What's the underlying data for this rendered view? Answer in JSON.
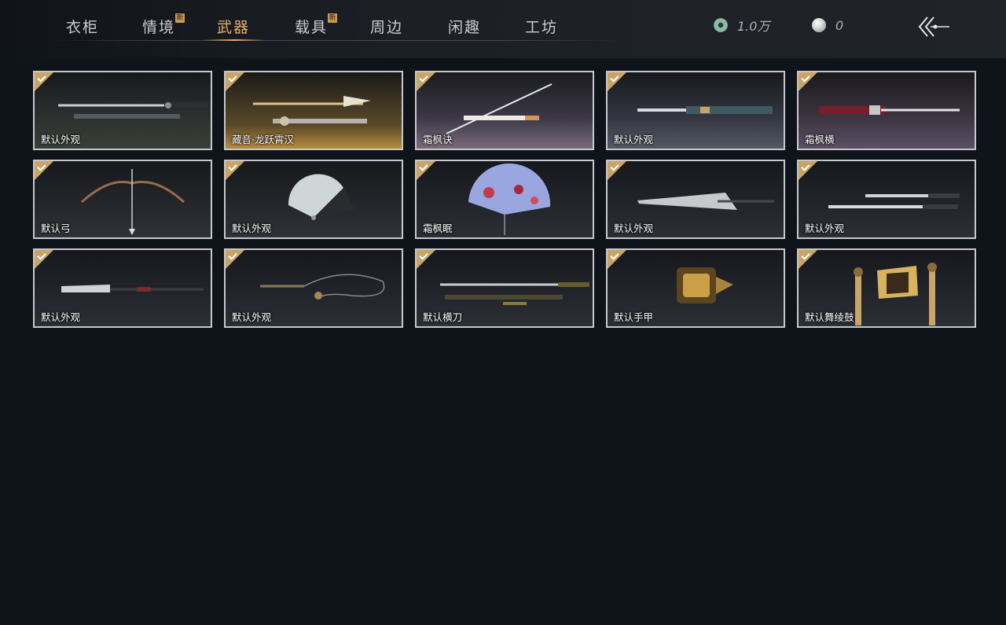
{
  "tabs": [
    {
      "label": "衣柜",
      "active": false,
      "new_badge": ""
    },
    {
      "label": "情境",
      "active": false,
      "new_badge": "新"
    },
    {
      "label": "武器",
      "active": true,
      "new_badge": ""
    },
    {
      "label": "载具",
      "active": false,
      "new_badge": "新"
    },
    {
      "label": "周边",
      "active": false,
      "new_badge": ""
    },
    {
      "label": "闲趣",
      "active": false,
      "new_badge": ""
    },
    {
      "label": "工坊",
      "active": false,
      "new_badge": ""
    }
  ],
  "currency": {
    "coins": {
      "icon": "jade-coin-icon",
      "value": "1.0万"
    },
    "pearls": {
      "icon": "pearl-icon",
      "value": "0"
    }
  },
  "back_button": {
    "icon": "back-arrow-icon"
  },
  "items": [
    {
      "name": "默认外观",
      "owned": true,
      "icon": "sword-pair-icon"
    },
    {
      "name": "藏音·龙跃霄汉",
      "owned": true,
      "icon": "ornate-spear-icon"
    },
    {
      "name": "霜枫诀",
      "owned": true,
      "icon": "katana-icon"
    },
    {
      "name": "默认外观",
      "owned": true,
      "icon": "blade-sheath-icon"
    },
    {
      "name": "霜枫横",
      "owned": true,
      "icon": "red-blade-icon"
    },
    {
      "name": "默认弓",
      "owned": true,
      "icon": "bow-icon"
    },
    {
      "name": "默认外观",
      "owned": true,
      "icon": "fan-icon"
    },
    {
      "name": "霜枫眠",
      "owned": true,
      "icon": "maple-fan-icon"
    },
    {
      "name": "默认外观",
      "owned": true,
      "icon": "umbrella-icon"
    },
    {
      "name": "默认外观",
      "owned": true,
      "icon": "twin-dao-icon"
    },
    {
      "name": "默认外观",
      "owned": true,
      "icon": "glaive-icon"
    },
    {
      "name": "默认外观",
      "owned": true,
      "icon": "rope-dart-icon"
    },
    {
      "name": "默认横刀",
      "owned": true,
      "icon": "hengdao-icon"
    },
    {
      "name": "默认手甲",
      "owned": true,
      "icon": "gauntlet-icon"
    },
    {
      "name": "默认舞绫鼓",
      "owned": true,
      "icon": "drum-icon"
    }
  ]
}
